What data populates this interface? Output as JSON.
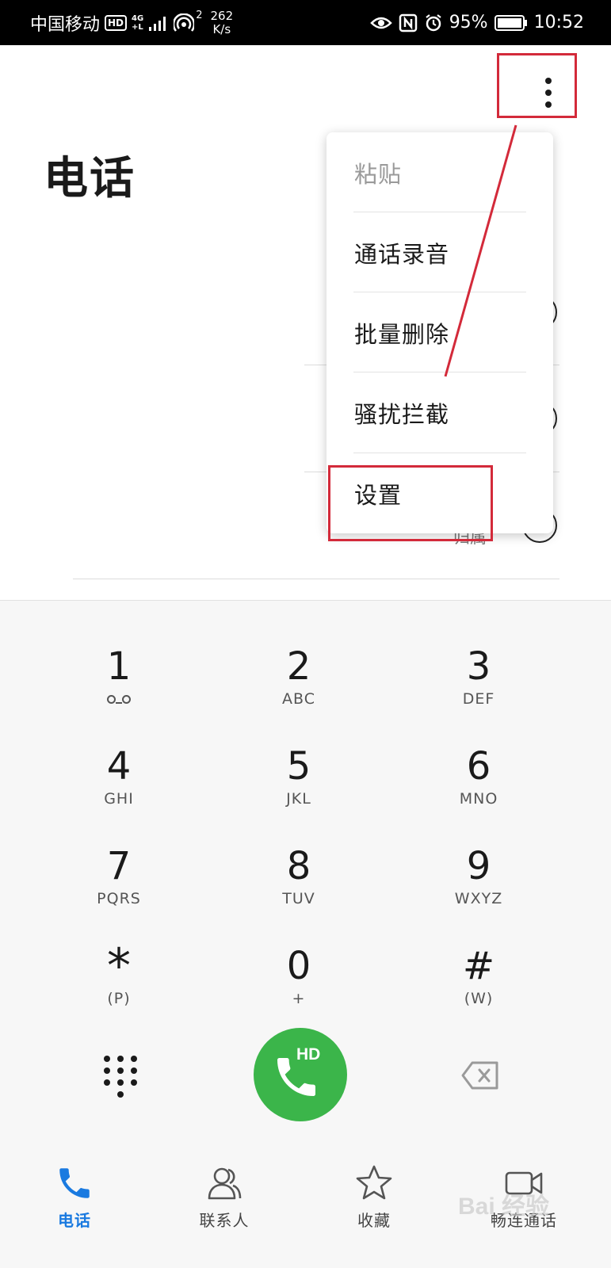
{
  "status_bar": {
    "carrier": "中国移动",
    "hd_badge": "HD",
    "network_top": "4G",
    "network_bottom": "+L",
    "hotspot_count": "2",
    "net_speed_value": "262",
    "net_speed_unit": "K/s",
    "battery": "95%",
    "time": "10:52"
  },
  "header": {
    "title": "电话"
  },
  "overflow_menu": {
    "items": [
      {
        "label": "粘贴",
        "enabled": false
      },
      {
        "label": "通话录音",
        "enabled": true
      },
      {
        "label": "批量删除",
        "enabled": true
      },
      {
        "label": "骚扰拦截",
        "enabled": true
      },
      {
        "label": "设置",
        "enabled": true
      }
    ]
  },
  "background_list": {
    "partial_text": "归属"
  },
  "dialpad": {
    "keys": [
      {
        "digit": "1",
        "letters": ""
      },
      {
        "digit": "2",
        "letters": "ABC"
      },
      {
        "digit": "3",
        "letters": "DEF"
      },
      {
        "digit": "4",
        "letters": "GHI"
      },
      {
        "digit": "5",
        "letters": "JKL"
      },
      {
        "digit": "6",
        "letters": "MNO"
      },
      {
        "digit": "7",
        "letters": "PQRS"
      },
      {
        "digit": "8",
        "letters": "TUV"
      },
      {
        "digit": "9",
        "letters": "WXYZ"
      },
      {
        "digit": "*",
        "letters": "(P)"
      },
      {
        "digit": "0",
        "letters": "+"
      },
      {
        "digit": "#",
        "letters": "(W)"
      }
    ],
    "call_button_badge": "HD"
  },
  "bottom_nav": {
    "items": [
      {
        "label": "电话",
        "icon": "phone-icon",
        "active": true
      },
      {
        "label": "联系人",
        "icon": "contacts-icon",
        "active": false
      },
      {
        "label": "收藏",
        "icon": "star-icon",
        "active": false
      },
      {
        "label": "畅连通话",
        "icon": "video-call-icon",
        "active": false
      }
    ]
  },
  "watermark": "Bai 经验",
  "colors": {
    "accent": "#1a7ae0",
    "call_green": "#3bb54a",
    "annotation_red": "#d32a3a"
  }
}
